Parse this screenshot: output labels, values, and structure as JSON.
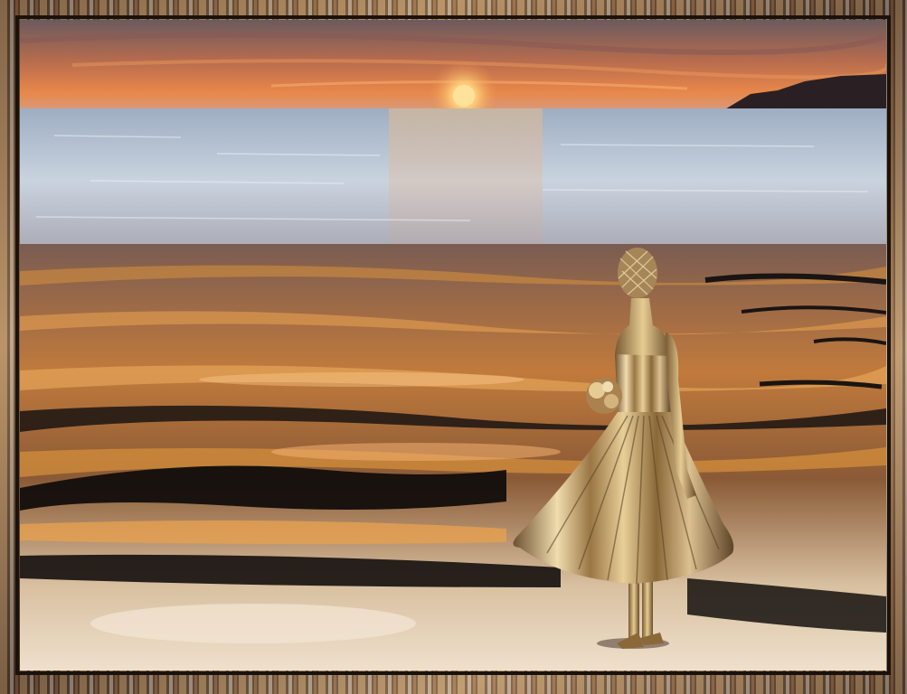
{
  "scene": {
    "description_tags": [
      "sunset",
      "sea",
      "rippled-water",
      "golden-dress-statue",
      "decorative-frame"
    ],
    "colors": {
      "sky_top": "#6b5a5e",
      "sky_glow": "#e8874a",
      "sun": "#ffd07a",
      "sea_light": "#c9d3df",
      "sea_mid": "#8fa3b8",
      "ripple_gold": "#d9913c",
      "ripple_dark": "#1a1412",
      "ripple_cream": "#efe0cc",
      "headland": "#2a2024",
      "dress_gold": "#b89458",
      "dress_highlight": "#f0dcae",
      "frame_dark": "#3b2a20",
      "frame_gold": "#c8a070"
    }
  }
}
